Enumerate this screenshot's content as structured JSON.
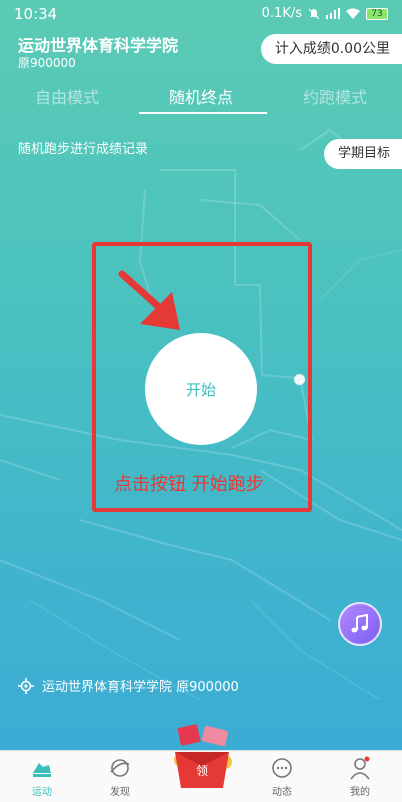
{
  "status_bar": {
    "time": "10:34",
    "net_speed": "0.1K/s",
    "battery": "73"
  },
  "header": {
    "school_name": "运动世界体育科学学院",
    "school_sub": "原900000",
    "score_button": "计入成绩0.00公里"
  },
  "tabs": [
    {
      "label": "自由模式",
      "active": false
    },
    {
      "label": "随机终点",
      "active": true
    },
    {
      "label": "约跑模式",
      "active": false
    }
  ],
  "main": {
    "description": "随机跑步进行成绩记录",
    "goal_button": "学期目标",
    "start_label": "开始",
    "hint": "点击按钮 开始跑步"
  },
  "location": {
    "text": "运动世界体育科学学院 原900000"
  },
  "bottom_nav": {
    "items": [
      {
        "label": "运动",
        "icon": "run-shoe-icon",
        "active": true
      },
      {
        "label": "发现",
        "icon": "planet-icon",
        "active": false
      },
      {
        "label": "领",
        "icon": "gift-box-icon",
        "active": false
      },
      {
        "label": "动态",
        "icon": "chat-bubble-icon",
        "active": false
      },
      {
        "label": "我的",
        "icon": "person-icon",
        "active": false
      }
    ]
  },
  "colors": {
    "accent": "#3cbfbb",
    "hint_red": "#e53935",
    "music_purple": "#8b6cf6"
  }
}
